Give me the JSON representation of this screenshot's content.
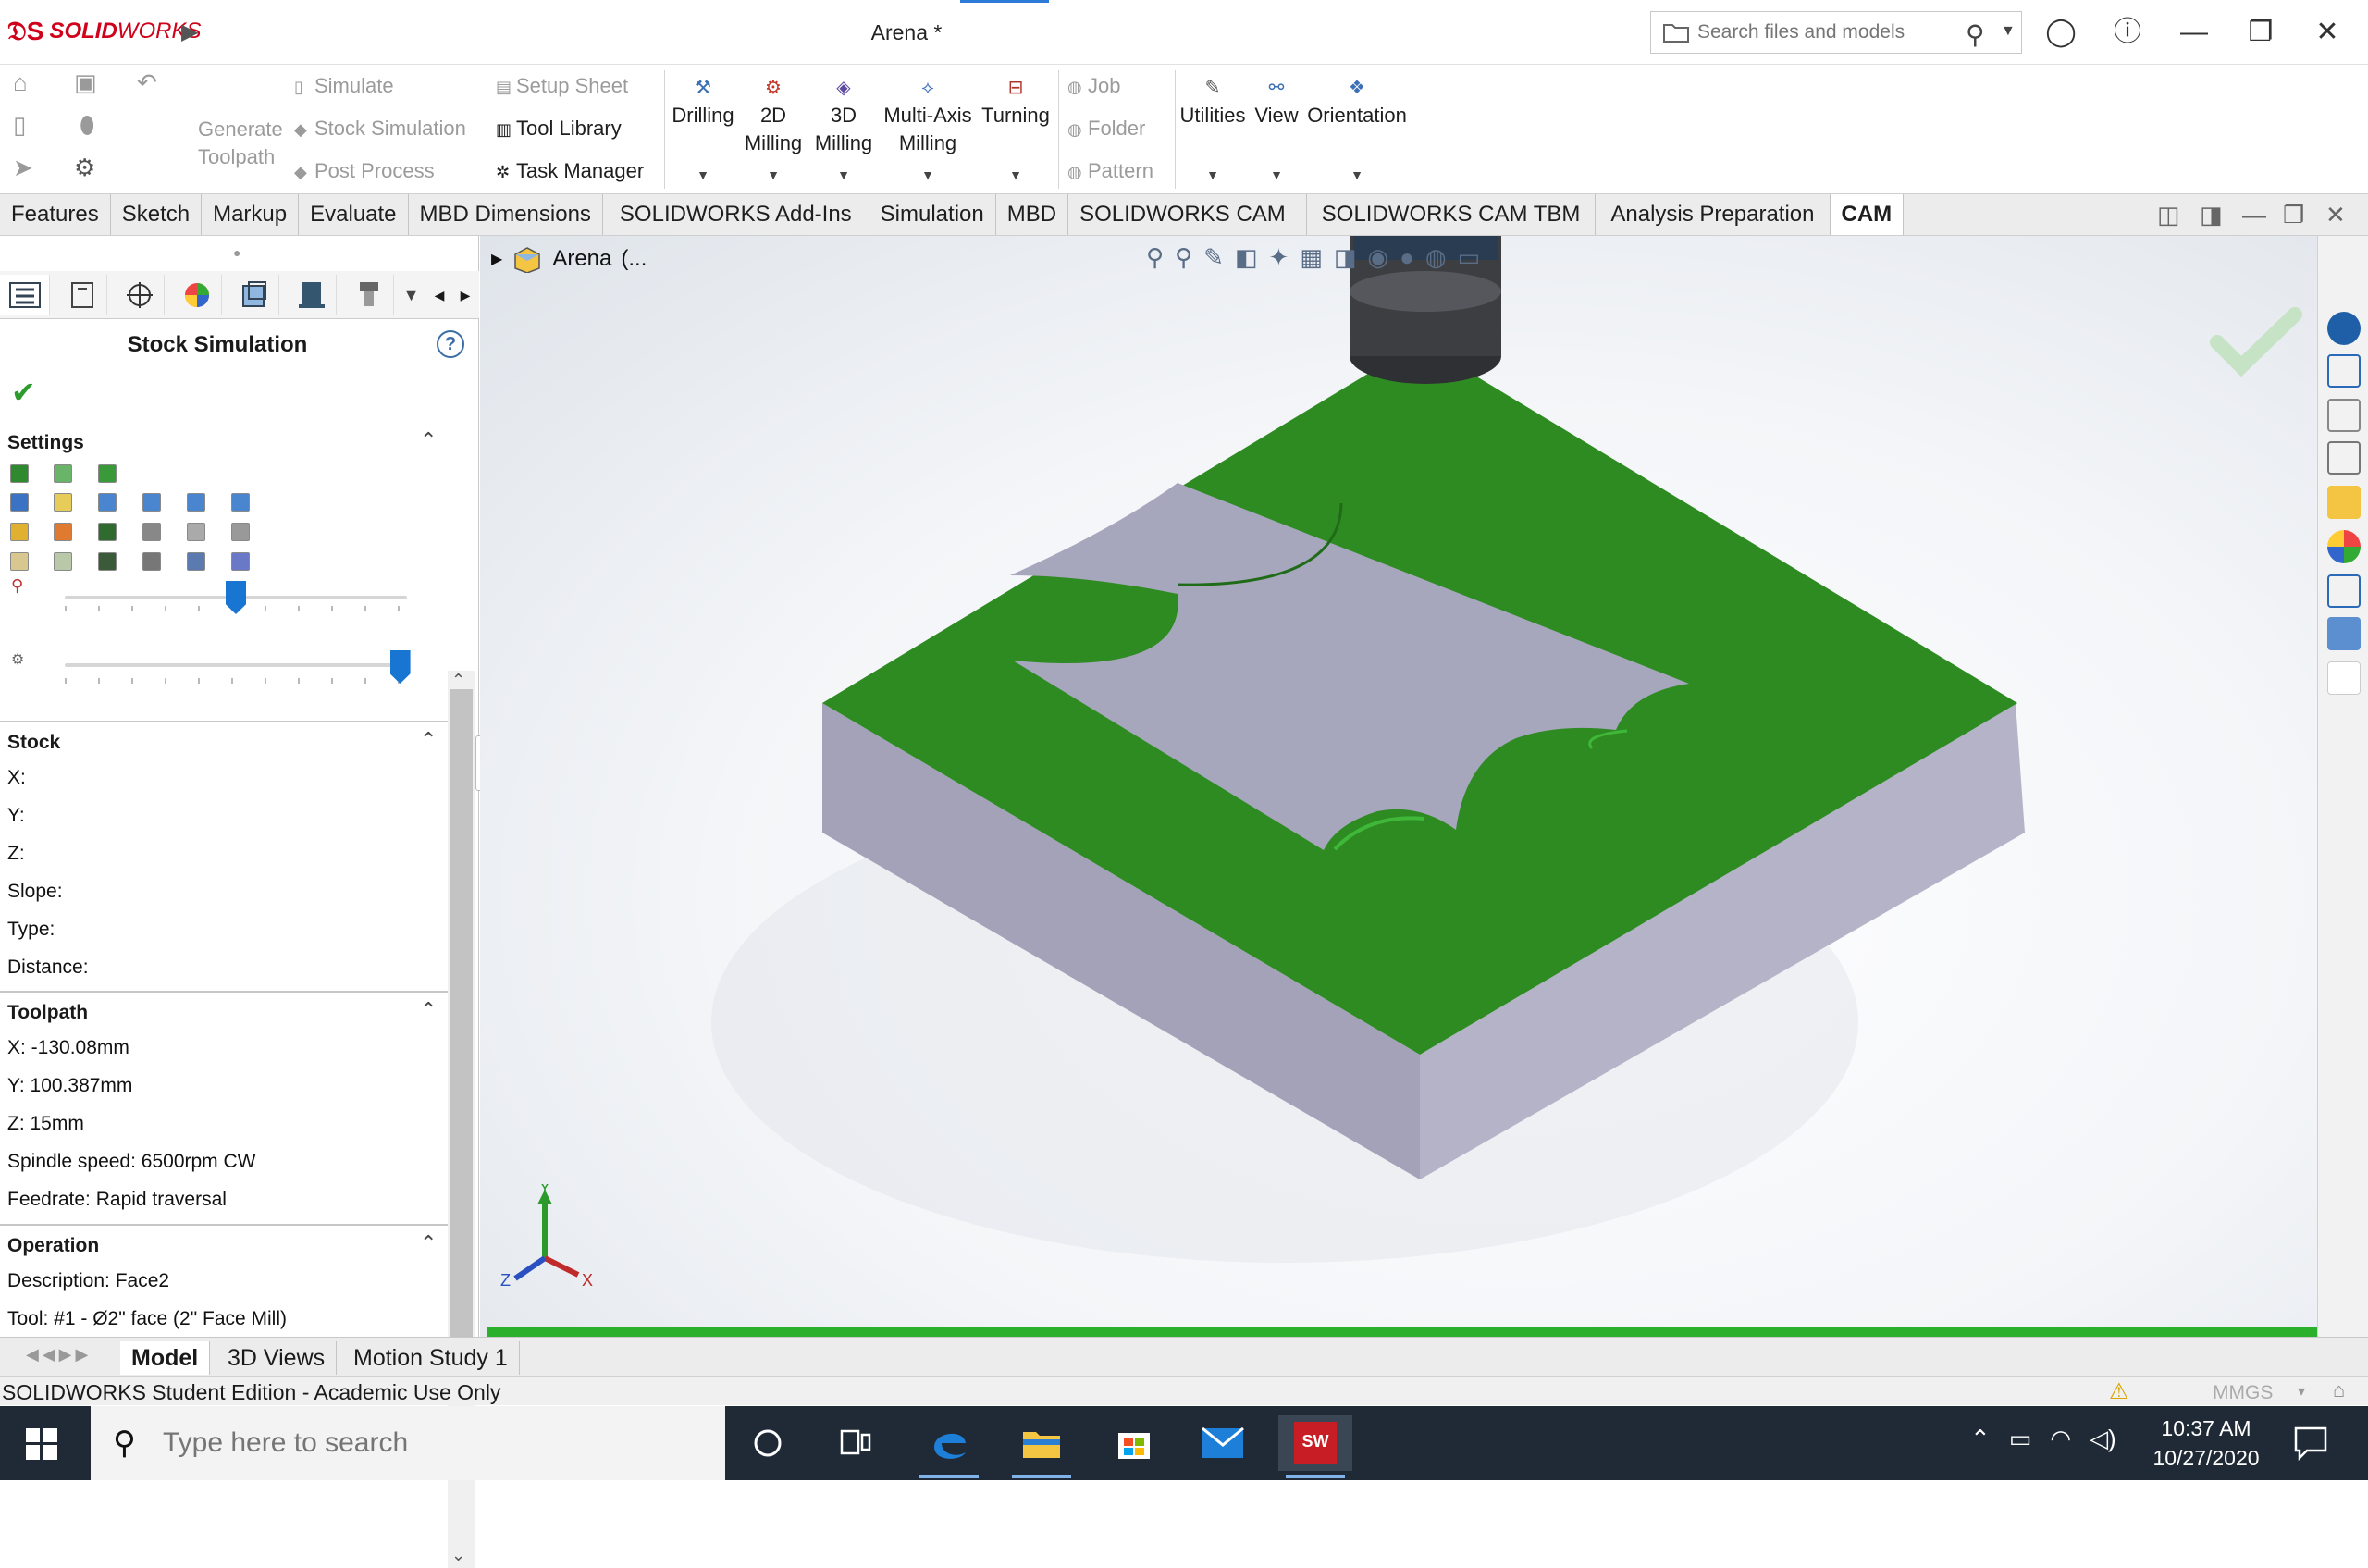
{
  "app": {
    "brand_solid": "SOLID",
    "brand_works": "WORKS",
    "doc_title": "Arena *",
    "search_placeholder": "Search files and models"
  },
  "toolbar": {
    "cam_left": {
      "generate_toolpath": "Generate Toolpath",
      "simulate": "Simulate",
      "stock_simulation": "Stock Simulation",
      "post_process": "Post Process",
      "setup_sheet": "Setup Sheet",
      "tool_library": "Tool Library",
      "task_manager": "Task Manager"
    },
    "machining": [
      {
        "label": "Drilling"
      },
      {
        "label": "2D\nMilling"
      },
      {
        "label": "3D\nMilling"
      },
      {
        "label": "Multi-Axis\nMilling"
      },
      {
        "label": "Turning"
      }
    ],
    "misc": {
      "job": "Job",
      "folder": "Folder",
      "pattern": "Pattern"
    },
    "right": [
      {
        "label": "Utilities"
      },
      {
        "label": "View"
      },
      {
        "label": "Orientation"
      }
    ]
  },
  "tabs": [
    "Features",
    "Sketch",
    "Markup",
    "Evaluate",
    "MBD Dimensions",
    "SOLIDWORKS Add-Ins",
    "Simulation",
    "MBD",
    "SOLIDWORKS CAM",
    "SOLIDWORKS CAM TBM",
    "Analysis Preparation",
    "CAM"
  ],
  "active_tab": "CAM",
  "property_manager": {
    "title": "Stock Simulation",
    "help": "?",
    "settings": {
      "heading": "Settings"
    },
    "stock": {
      "heading": "Stock",
      "x": "X:",
      "y": "Y:",
      "z": "Z:",
      "slope": "Slope:",
      "type": "Type:",
      "distance": "Distance:"
    },
    "toolpath": {
      "heading": "Toolpath",
      "x": "X: -130.08mm",
      "y": "Y: 100.387mm",
      "z": "Z: 15mm",
      "spindle": "Spindle speed: 6500rpm CW",
      "feedrate": "Feedrate: Rapid traversal"
    },
    "operation": {
      "heading": "Operation",
      "description": "Description: Face2",
      "tool": "Tool: #1 - Ø2\" face (2\" Face Mill)"
    },
    "slider_speed": 0.5,
    "slider_quality": 0.98
  },
  "feature_tree": {
    "root": "Arena",
    "suffix": "(..."
  },
  "triad": {
    "x": "X",
    "y": "Y",
    "z": "Z"
  },
  "simulation_progress": 1.0,
  "bottom_tabs": [
    "Model",
    "3D Views",
    "Motion Study 1"
  ],
  "status": {
    "text": "SOLIDWORKS Student Edition - Academic Use Only",
    "units": "MMGS"
  },
  "taskbar": {
    "search_placeholder": "Type here to search",
    "time": "10:37 AM",
    "date": "10/27/2020"
  },
  "colors": {
    "stock_top": "#2e8b22",
    "stock_side": "#a3a2b8",
    "pocket_floor": "#a6a6bc",
    "brand": "#d0021b",
    "progress": "#2bb02b",
    "taskbar": "#1f2a36"
  }
}
